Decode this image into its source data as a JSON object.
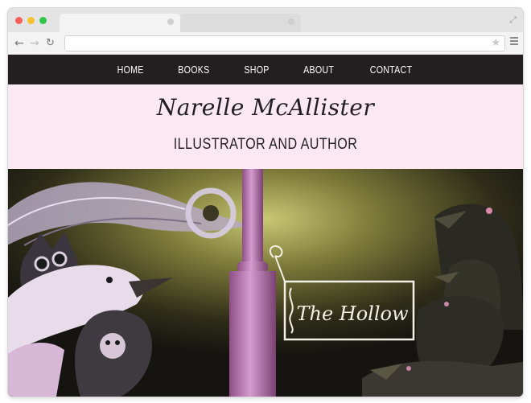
{
  "browser": {
    "url": "",
    "colors": {
      "close": "#f55e57",
      "minimize": "#f5c130",
      "zoom": "#31c64a"
    },
    "icons": [
      "back-arrow-icon",
      "forward-arrow-icon",
      "reload-icon",
      "star-icon",
      "menu-icon",
      "expand-icon"
    ]
  },
  "nav": {
    "items": [
      "HOME",
      "BOOKS",
      "SHOP",
      "ABOUT",
      "CONTACT"
    ]
  },
  "header": {
    "name": "Narelle McAllister",
    "tagline": "ILLUSTRATOR AND AUTHOR"
  },
  "banner": {
    "sign_text": "The Hollow"
  },
  "colors": {
    "nav_bg": "#231f20",
    "header_bg": "#fbe8f1",
    "text": "#231f20",
    "pillar": "#c886c1"
  }
}
